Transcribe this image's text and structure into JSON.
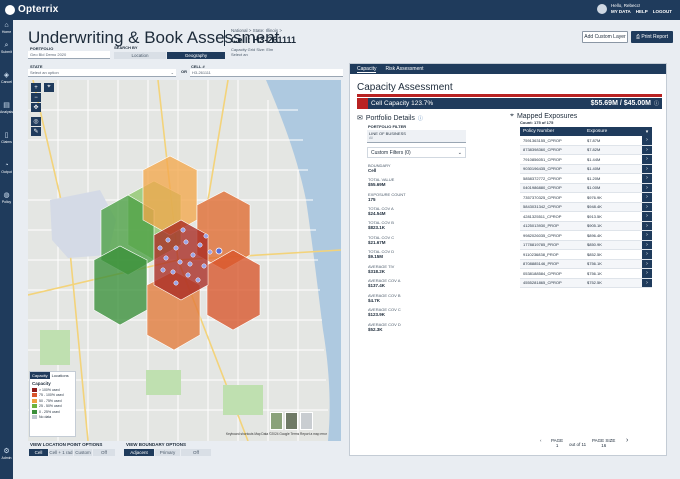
{
  "app": {
    "logo_text": "Opterrix"
  },
  "user": {
    "greeting": "Hello, Rebecc!",
    "menu": [
      "MY DATA",
      "HELP",
      "LOGOUT"
    ]
  },
  "nav": [
    "Home",
    "Submit",
    "Cancel",
    "Analysis",
    "Claims",
    "Output",
    "Policy",
    "Admin"
  ],
  "header": {
    "title": "Underwriting & Book Assessment",
    "breadcrumb": "National >  State: Illinois >",
    "cell": "Cell: H3-261111",
    "add_layer": "Add Custom Layer",
    "print": "Print Report"
  },
  "filters": {
    "portfolio_label": "PORTFOLIO",
    "portfolio_value": "Geo Bld Demo 2020",
    "search_by_label": "SEARCH BY",
    "search_location": "Location",
    "search_geography": "Geography",
    "hint": "Capacity Grid Size: Elm Select an",
    "state_label": "STATE",
    "state_value": "Select an option",
    "or": "OR",
    "cell_label": "CELL #",
    "cell_value": "H3-261111"
  },
  "legend": {
    "tabs": [
      "Capacity",
      "Locations"
    ],
    "title": "Capacity",
    "items": [
      {
        "label": "> 100% used",
        "color": "#8e1b1b"
      },
      {
        "label": "75 - 100% used",
        "color": "#d9542a"
      },
      {
        "label": "50 - 75% used",
        "color": "#f0a040"
      },
      {
        "label": "25 - 50% used",
        "color": "#6db33f"
      },
      {
        "label": "0 - 25% used",
        "color": "#3a8f3a"
      },
      {
        "label": "No data",
        "color": "#bfc7d0"
      }
    ]
  },
  "map_footer": "Keyboard shortcuts    Map Data ©2024 Google    Terms    Report a map error",
  "view_options": {
    "location_label": "VIEW LOCATION POINT OPTIONS",
    "location_options": [
      "Cell",
      "Cell + 1 rad",
      "Custom",
      "Off"
    ],
    "boundary_label": "VIEW BOUNDARY OPTIONS",
    "boundary_options": [
      "Adjacent",
      "Primary",
      "Off"
    ]
  },
  "panel": {
    "tabs": [
      "Capacity",
      "Risk Assessment"
    ],
    "heading": "Capacity Assessment",
    "cell_capacity": "Cell Capacity 123.7%",
    "capacity_value": "$55.69M / $45.00M",
    "portfolio_details": "Portfolio Details",
    "portfolio_filter": "PORTFOLIO FILTER",
    "lob_label": "LINE OF BUSINESS",
    "lob_value": "All",
    "custom_filters": "Custom Filters (0)",
    "details": [
      {
        "label": "BOUNDARY",
        "value": "Cell"
      },
      {
        "label": "TOTAL VALUE",
        "value": "$55.69M"
      },
      {
        "label": "EXPOSURE COUNT",
        "value": "175"
      },
      {
        "label": "TOTAL COV A",
        "value": "$24.54M"
      },
      {
        "label": "TOTAL COV B",
        "value": "$823.1K"
      },
      {
        "label": "TOTAL COV C",
        "value": "$21.67M"
      },
      {
        "label": "TOTAL COV D",
        "value": "$9.15M"
      },
      {
        "label": "AVERAGE TIV",
        "value": "$318.2K"
      },
      {
        "label": "AVERAGE COV A",
        "value": "$137.4K"
      },
      {
        "label": "AVERAGE COV B",
        "value": "$4.7K"
      },
      {
        "label": "AVERAGE COV C",
        "value": "$123.9K"
      },
      {
        "label": "AVERAGE COV D",
        "value": "$52.3K"
      }
    ],
    "mapped_exposures": "Mapped Exposures",
    "exposure_count": "Count: 175 of 175",
    "table_headers": [
      "Policy Number",
      "Exposure"
    ],
    "rows": [
      [
        "7591363155_CPROP",
        "$7.87M"
      ],
      [
        "8738398360_CPROP",
        "$7.82M"
      ],
      [
        "7910856051_CPROP",
        "$1.44M"
      ],
      [
        "9030196435_CPROP",
        "$1.40M"
      ],
      [
        "5858372772_CPROP",
        "$1.20M"
      ],
      [
        "0401986880_CPROP",
        "$1.00M"
      ],
      [
        "7357370325_CPROP",
        "$976.9K"
      ],
      [
        "5843031342_CPROP",
        "$948.4K"
      ],
      [
        "4281325511_CPROP",
        "$913.5K"
      ],
      [
        "4125013930_PROP",
        "$905.1K"
      ],
      [
        "9982026035_CPROP",
        "$896.4K"
      ],
      [
        "1778819785_PROP",
        "$850.9K"
      ],
      [
        "9110236838_PROP",
        "$852.5K"
      ],
      [
        "8708885146_PROP",
        "$756.1K"
      ],
      [
        "0538188584_CPROP",
        "$756.1K"
      ],
      [
        "4555281865_CPROP",
        "$752.5K"
      ]
    ],
    "page_label": "PAGE",
    "page_value": "1",
    "out_of": "out of 11",
    "page_size_label": "PAGE SIZE",
    "page_size_value": "16"
  }
}
